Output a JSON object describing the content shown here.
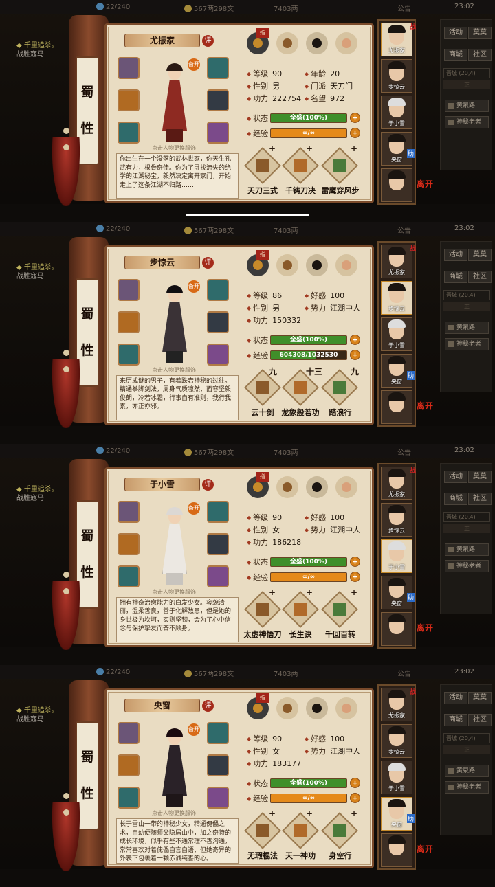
{
  "header": {
    "stamina": "22/240",
    "money": "567两298文",
    "silver": "7403两",
    "notice": "公告",
    "time": "23:02"
  },
  "quest": {
    "title": "千里追杀。",
    "line2": "战胜寇马"
  },
  "right_panel": {
    "btn1": "活动",
    "btn2": "莫莫",
    "btn3": "商城",
    "btn4": "社区",
    "city": "晋城",
    "city_val": "(20,4)",
    "area": "正",
    "list1": "黄泉路",
    "list2": "神秘老者"
  },
  "common": {
    "clan_char1": "蜀",
    "clan_char2": "性",
    "ping": "评",
    "equip_hint": "点击人物更换服饰",
    "state_label": "状态",
    "exp_label": "经验",
    "zhi": "指"
  },
  "roster": {
    "names": [
      "尤振家",
      "步惊云",
      "于小雪",
      "央窗",
      ""
    ],
    "zhan": "战",
    "zhu": "助",
    "leave": "离开"
  },
  "screens": [
    {
      "name": "尤振家",
      "hero_style": "red",
      "buff": "备开",
      "selected": 0,
      "stats": [
        [
          "等级",
          "90"
        ],
        [
          "年龄",
          "20"
        ],
        [
          "性别",
          "男"
        ],
        [
          "门派",
          "天刀门"
        ],
        [
          "功力",
          "222754"
        ],
        [
          "名望",
          "972"
        ]
      ],
      "state": "全盛(100%)",
      "exp": "∞/∞",
      "exp_pct": 100,
      "exp_color": "#e58a1a",
      "bio": "你出生在一个没落的武林世家，你天生孔武有力，根骨奇佳。你为了寻找流失的绝学的江湖秘宝，毅然决定离开家门，开始走上了这条江湖不归路……",
      "skills": [
        [
          "+",
          "天刀三式"
        ],
        [
          "+",
          "千铸刀决"
        ],
        [
          "+",
          "雷鹰穿风步"
        ]
      ]
    },
    {
      "name": "步惊云",
      "hero_style": "dark",
      "buff": "备开",
      "selected": 1,
      "stats": [
        [
          "等级",
          "86"
        ],
        [
          "好感",
          "100"
        ],
        [
          "性别",
          "男"
        ],
        [
          "势力",
          "江湖中人"
        ],
        [
          "功力",
          "150332"
        ],
        [
          "",
          ""
        ]
      ],
      "state": "全盛(100%)",
      "exp": "604308/1032530",
      "exp_pct": 59,
      "exp_color": "#3f8f2a",
      "bio": "来历成谜的男子，有着跌宕神秘的过往。精通拳脚剑法，周身气质凛然，面容坚毅俊朗，冷若冰霜，行事自有准则，我行我素，亦正亦邪。",
      "skills": [
        [
          "九",
          "云十剑"
        ],
        [
          "十三",
          "龙象般若功"
        ],
        [
          "九",
          "踏浪行"
        ]
      ]
    },
    {
      "name": "于小雪",
      "hero_style": "white",
      "buff": "备开",
      "selected": 2,
      "stats": [
        [
          "等级",
          "90"
        ],
        [
          "好感",
          "100"
        ],
        [
          "性别",
          "女"
        ],
        [
          "势力",
          "江湖中人"
        ],
        [
          "功力",
          "186218"
        ],
        [
          "",
          ""
        ]
      ],
      "state": "全盛(100%)",
      "exp": "∞/∞",
      "exp_pct": 100,
      "exp_color": "#e58a1a",
      "bio": "拥有神奇治愈能力的白发少女。容貌清丽，温柔善良，善于化解敌意，但是她的身世极为坎坷，实则坚韧，会为了心中信念与保护挚友而奋不顾身。",
      "skills": [
        [
          "+",
          "太虚神悟刀"
        ],
        [
          "+",
          "长生诀"
        ],
        [
          "+",
          "千回百转"
        ]
      ]
    },
    {
      "name": "央窗",
      "hero_style": "black",
      "buff": "备开",
      "selected": 3,
      "stats": [
        [
          "等级",
          "90"
        ],
        [
          "好感",
          "100"
        ],
        [
          "性别",
          "女"
        ],
        [
          "势力",
          "江湖中人"
        ],
        [
          "功力",
          "183177"
        ],
        [
          "",
          ""
        ]
      ],
      "state": "全盛(100%)",
      "exp": "∞/∞",
      "exp_pct": 100,
      "exp_color": "#e58a1a",
      "bio": "长于雷山一带的神秘少女，精通傀儡之术，自幼便随师父隐居山中，加之奇特的成长环境，似乎有些不通常理不善沟通，常常喜欢对着傀儡自言自语，但她奇异的外表下包裹着一颗赤诚纯善的心。",
      "skills": [
        [
          "+",
          "无瑕棍法"
        ],
        [
          "+",
          "天一神功"
        ],
        [
          "+",
          "身空行"
        ]
      ]
    }
  ]
}
